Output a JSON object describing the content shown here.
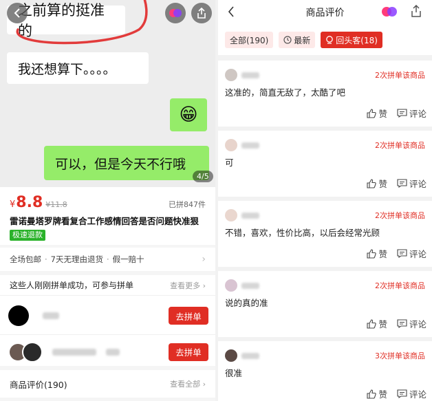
{
  "left": {
    "chat": {
      "bubble1": "之前算的挺准的",
      "bubble2": "我还想算下。。。。",
      "bubble3": "😁",
      "bubble4": "可以，但是今天不行哦",
      "pager": "4/5"
    },
    "product": {
      "currency": "¥",
      "price": "8.8",
      "orig_price": "¥11.8",
      "sold": "已拼847件",
      "title": "雷诺曼塔罗牌看复合工作感情回答是否问题快准狠",
      "fast_refund": "极速退款"
    },
    "guarantees": [
      "全场包邮",
      "7天无理由退货",
      "假一赔十"
    ],
    "group": {
      "heading": "这些人刚刚拼单成功，可参与拼单",
      "more": "查看更多",
      "join_label": "去拼单"
    },
    "reviews_link": {
      "label": "商品评价(190)",
      "more": "查看全部"
    }
  },
  "right": {
    "title": "商品评价",
    "filters": [
      {
        "label": "全部(190)"
      },
      {
        "label": "最新"
      },
      {
        "label": "回头客(18)"
      }
    ],
    "like_label": "赞",
    "comment_label": "评论",
    "reviews": [
      {
        "badge": "2次拼单该商品",
        "text": "这准的，简直无敌了，太酷了吧"
      },
      {
        "badge": "2次拼单该商品",
        "text": "可"
      },
      {
        "badge": "2次拼单该商品",
        "text": "不错，喜欢，性价比高，以后会经常光顾"
      },
      {
        "badge": "2次拼单该商品",
        "text": "说的真的准"
      },
      {
        "badge": "3次拼单该商品",
        "text": "很准"
      }
    ]
  },
  "colors": {
    "accent": "#e02e24",
    "wechat_green": "#95ec69",
    "refund_green": "#2ab22a"
  }
}
